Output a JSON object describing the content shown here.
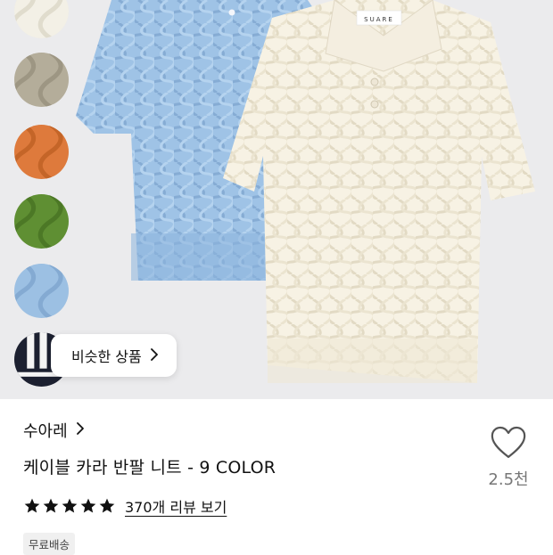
{
  "hero": {
    "background": "#ebebed",
    "swatches": [
      {
        "name": "ivory",
        "color": "#f3f0e6"
      },
      {
        "name": "beige",
        "color": "#b4ad9a"
      },
      {
        "name": "orange",
        "color": "#de7a3c"
      },
      {
        "name": "green",
        "color": "#5f8f33"
      },
      {
        "name": "sky-blue",
        "color": "#9cc0e3"
      },
      {
        "name": "navy-stripe",
        "color": "#1c2030"
      }
    ],
    "similar_button": {
      "label": "비슷한 상품",
      "icon": "chevron-right-icon"
    },
    "shirt_brand_tag": "SUARE"
  },
  "product": {
    "brand": "수아레",
    "brand_icon": "chevron-right-icon",
    "title": "케이블 카라 반팔 니트 - 9 COLOR",
    "rating_stars": 5,
    "review_link": "370개 리뷰 보기",
    "badge": "무료배송",
    "like_icon": "heart-outline-icon",
    "like_count": "2.5천"
  }
}
